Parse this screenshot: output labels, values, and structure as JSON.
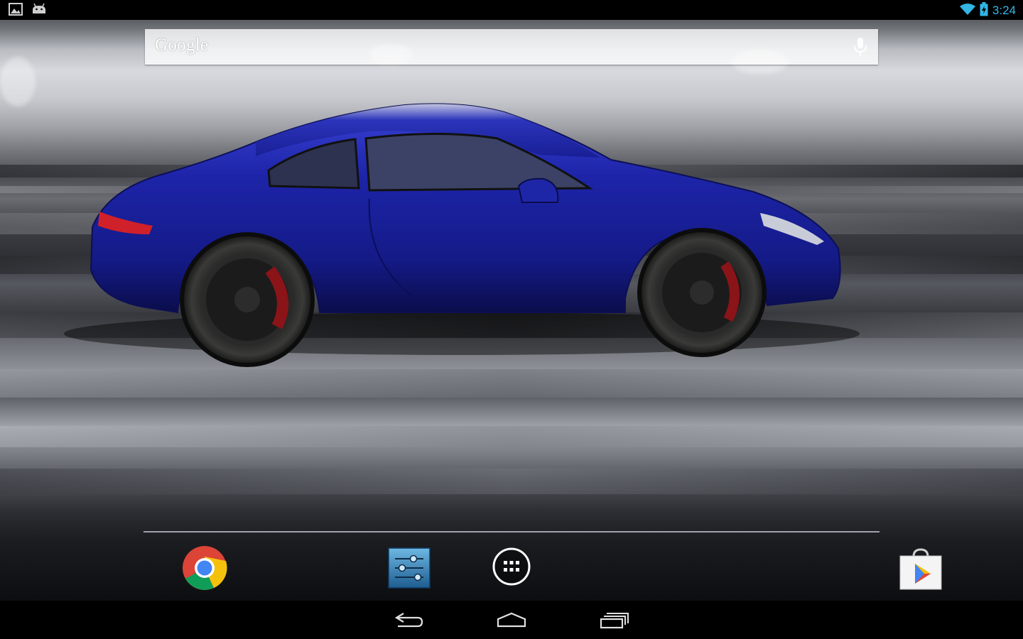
{
  "status_bar": {
    "left_icons": [
      "gallery-notification-icon",
      "android-notification-icon"
    ],
    "right_icons": [
      "wifi-icon",
      "battery-charging-icon"
    ],
    "time": "3:24",
    "accent_color": "#33b5e5"
  },
  "search": {
    "label": "Google",
    "voice_icon": "microphone-icon"
  },
  "wallpaper": {
    "subject": "blue-sports-car",
    "car_color": "#1a1f9e"
  },
  "dock": {
    "items": [
      {
        "name": "chrome-app",
        "icon": "chrome-icon"
      },
      {
        "name": "settings-app",
        "icon": "settings-sliders-icon"
      },
      {
        "name": "all-apps-button",
        "icon": "app-drawer-icon"
      },
      {
        "name": "play-store-app",
        "icon": "play-store-icon"
      }
    ]
  },
  "nav_bar": {
    "buttons": [
      "back-icon",
      "home-icon",
      "recent-apps-icon"
    ]
  }
}
